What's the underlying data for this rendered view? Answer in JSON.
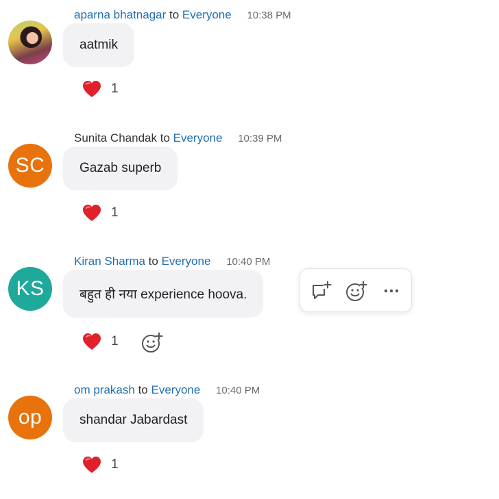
{
  "messages": [
    {
      "sender": "aparna bhatnagar",
      "to_word": "to",
      "recipient": "Everyone",
      "time": "10:38 PM",
      "avatar": {
        "type": "photo",
        "initials": "",
        "color": ""
      },
      "text": "aatmik",
      "reaction": {
        "emoji": "heart-icon",
        "count": "1"
      }
    },
    {
      "sender": "Sunita Chandak",
      "to_word": "to",
      "recipient": "Everyone",
      "time": "10:39 PM",
      "avatar": {
        "type": "initials",
        "initials": "SC",
        "color": "#e8730c"
      },
      "text": "Gazab superb",
      "reaction": {
        "emoji": "heart-icon",
        "count": "1"
      }
    },
    {
      "sender": "Kiran Sharma",
      "to_word": "to",
      "recipient": "Everyone",
      "time": "10:40 PM",
      "avatar": {
        "type": "initials",
        "initials": "KS",
        "color": "#1fa99a"
      },
      "text": "बहुत ही  नया experience hoova.",
      "reaction": {
        "emoji": "heart-icon",
        "count": "1"
      },
      "hovered": true
    },
    {
      "sender": "om prakash",
      "to_word": "to",
      "recipient": "Everyone",
      "time": "10:40 PM",
      "avatar": {
        "type": "initials",
        "initials": "op",
        "color": "#e8730c"
      },
      "text": "shandar Jabardast",
      "reaction": {
        "emoji": "heart-icon",
        "count": "1"
      }
    }
  ],
  "hover_actions": [
    "reply-in-thread-icon",
    "add-reaction-icon",
    "more-options-icon"
  ],
  "colors": {
    "name_link": "#1f6fb2",
    "bubble_bg": "#f2f2f5",
    "heart": "#e0202b",
    "icon": "#555555"
  }
}
